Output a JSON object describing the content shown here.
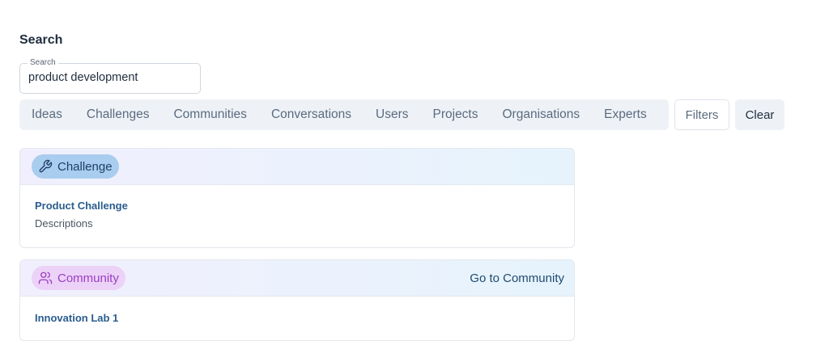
{
  "search": {
    "heading": "Search",
    "legend": "Search",
    "value": "product development"
  },
  "tabs": [
    {
      "label": "Ideas"
    },
    {
      "label": "Challenges"
    },
    {
      "label": "Communities"
    },
    {
      "label": "Conversations"
    },
    {
      "label": "Users"
    },
    {
      "label": "Projects"
    },
    {
      "label": "Organisations"
    },
    {
      "label": "Experts"
    }
  ],
  "actions": {
    "filters_label": "Filters",
    "clear_label": "Clear"
  },
  "results": [
    {
      "type_label": "Challenge",
      "icon": "wrench-icon",
      "title": "Product Challenge",
      "description": "Descriptions",
      "link_label": ""
    },
    {
      "type_label": "Community",
      "icon": "users-icon",
      "title": "Innovation Lab 1",
      "description": "",
      "link_label": "Go to Community"
    }
  ],
  "colors": {
    "challenge_badge_bg": "#a9cdee",
    "community_badge_bg": "#ecd2f7",
    "community_badge_text": "#9b3ec4",
    "title_link": "#2a5d8f",
    "tab_bar_bg": "#eef2f6"
  }
}
